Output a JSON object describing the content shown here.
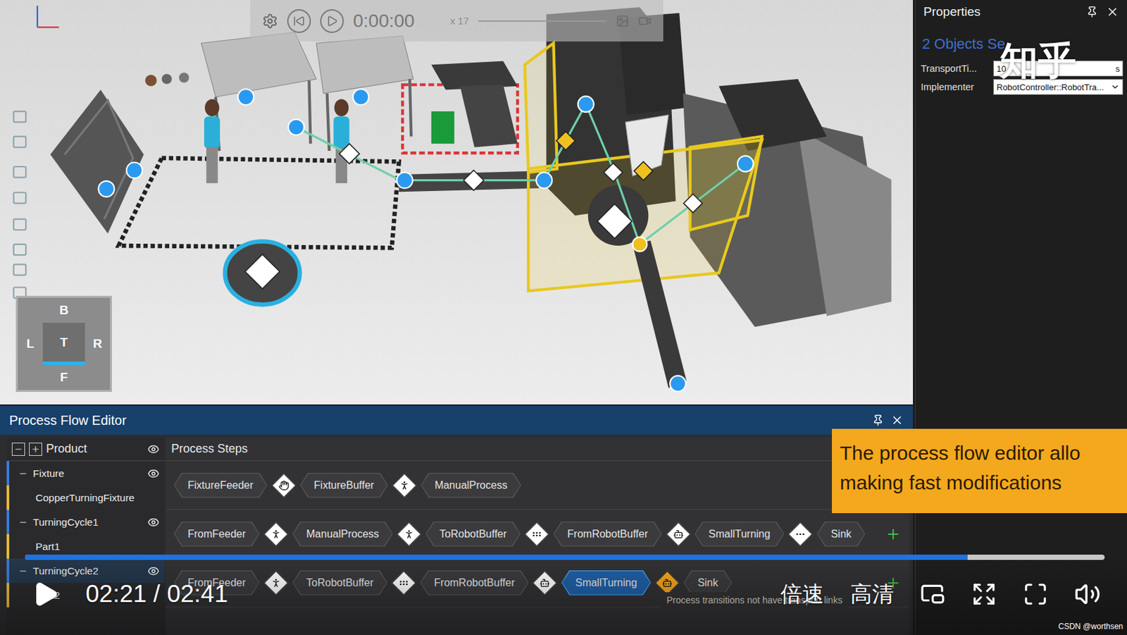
{
  "playback": {
    "time": "0:00:00",
    "speed": "x 17",
    "playing": false
  },
  "viewcube": {
    "top": "B",
    "left": "L",
    "center": "T",
    "right": "R",
    "bottom": "F"
  },
  "properties": {
    "title": "Properties",
    "subtitle": "2 Objects Se",
    "fields": [
      {
        "label": "TransportTi...",
        "value": "10",
        "unit": "s",
        "kind": "number"
      },
      {
        "label": "Implementer",
        "value": "RobotController::RobotTra...",
        "unit": "",
        "kind": "dropdown"
      }
    ]
  },
  "watermark": "知乎",
  "process_flow": {
    "title": "Process Flow Editor",
    "tree_header": "Product",
    "steps_header": "Process Steps",
    "products": [
      {
        "name": "Fixture",
        "expanded": true,
        "visible": true,
        "selected": false,
        "part": "CopperTurningFixture",
        "addable": false,
        "steps": [
          {
            "name": "FixtureFeeder",
            "selected": false
          },
          {
            "name": "FixtureBuffer",
            "selected": false
          },
          {
            "name": "ManualProcess",
            "selected": false
          }
        ],
        "transitions": [
          {
            "kind": "transfer",
            "warning": false
          },
          {
            "kind": "human",
            "warning": false
          }
        ]
      },
      {
        "name": "TurningCycle1",
        "expanded": true,
        "visible": true,
        "selected": false,
        "part": "Part1",
        "addable": true,
        "steps": [
          {
            "name": "FromFeeder",
            "selected": false
          },
          {
            "name": "ManualProcess",
            "selected": false
          },
          {
            "name": "ToRobotBuffer",
            "selected": false
          },
          {
            "name": "FromRobotBuffer",
            "selected": false
          },
          {
            "name": "SmallTurning",
            "selected": false
          },
          {
            "name": "Sink",
            "selected": false
          }
        ],
        "transitions": [
          {
            "kind": "human",
            "warning": false
          },
          {
            "kind": "human",
            "warning": false
          },
          {
            "kind": "conveyor",
            "warning": false
          },
          {
            "kind": "robot",
            "warning": false
          },
          {
            "kind": "dots",
            "warning": false
          }
        ]
      },
      {
        "name": "TurningCycle2",
        "expanded": true,
        "visible": true,
        "selected": true,
        "part": "Part2",
        "addable": true,
        "steps": [
          {
            "name": "FromFeeder",
            "selected": false
          },
          {
            "name": "ToRobotBuffer",
            "selected": false
          },
          {
            "name": "FromRobotBuffer",
            "selected": false
          },
          {
            "name": "SmallTurning",
            "selected": true
          },
          {
            "name": "Sink",
            "selected": false
          }
        ],
        "transitions": [
          {
            "kind": "human",
            "warning": false
          },
          {
            "kind": "conveyor",
            "warning": false
          },
          {
            "kind": "robot",
            "warning": false
          },
          {
            "kind": "robot",
            "warning": true
          }
        ]
      }
    ]
  },
  "caption": [
    "The process flow editor allo",
    "making fast modifications"
  ],
  "tooltip": "Process transitions not have transport links",
  "video": {
    "playing": false,
    "time": "02:21 / 02:41",
    "progress": 0.873,
    "speed": "倍速",
    "quality": "高清"
  },
  "credit": "CSDN @worthsen"
}
